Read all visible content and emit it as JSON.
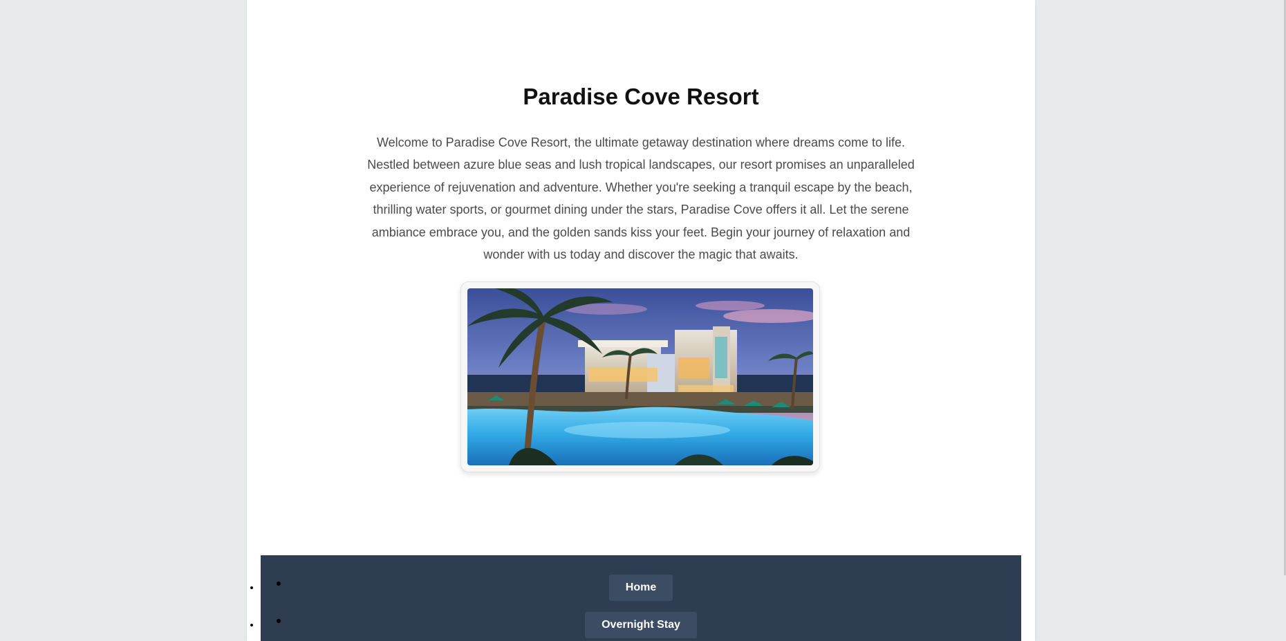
{
  "page": {
    "title": "Paradise Cove Resort",
    "intro": "Welcome to Paradise Cove Resort, the ultimate getaway destination where dreams come to life. Nestled between azure blue seas and lush tropical landscapes, our resort promises an unparalleled experience of rejuvenation and adventure. Whether you're seeking a tranquil escape by the beach, thrilling water sports, or gourmet dining under the stars, Paradise Cove offers it all. Let the serene ambiance embrace you, and the golden sands kiss your feet. Begin your journey of relaxation and wonder with us today and discover the magic that awaits."
  },
  "hero_image": {
    "subject": "resort-pool-at-dusk"
  },
  "nav": {
    "items": [
      {
        "label": "Home"
      },
      {
        "label": "Overnight Stay"
      }
    ]
  },
  "colors": {
    "page_background": "#e9eaed",
    "content_background": "#ffffff",
    "nav_background": "#2e3d51",
    "nav_button": "#3b4c63",
    "text": "#4a4a4a",
    "title": "#111111"
  }
}
